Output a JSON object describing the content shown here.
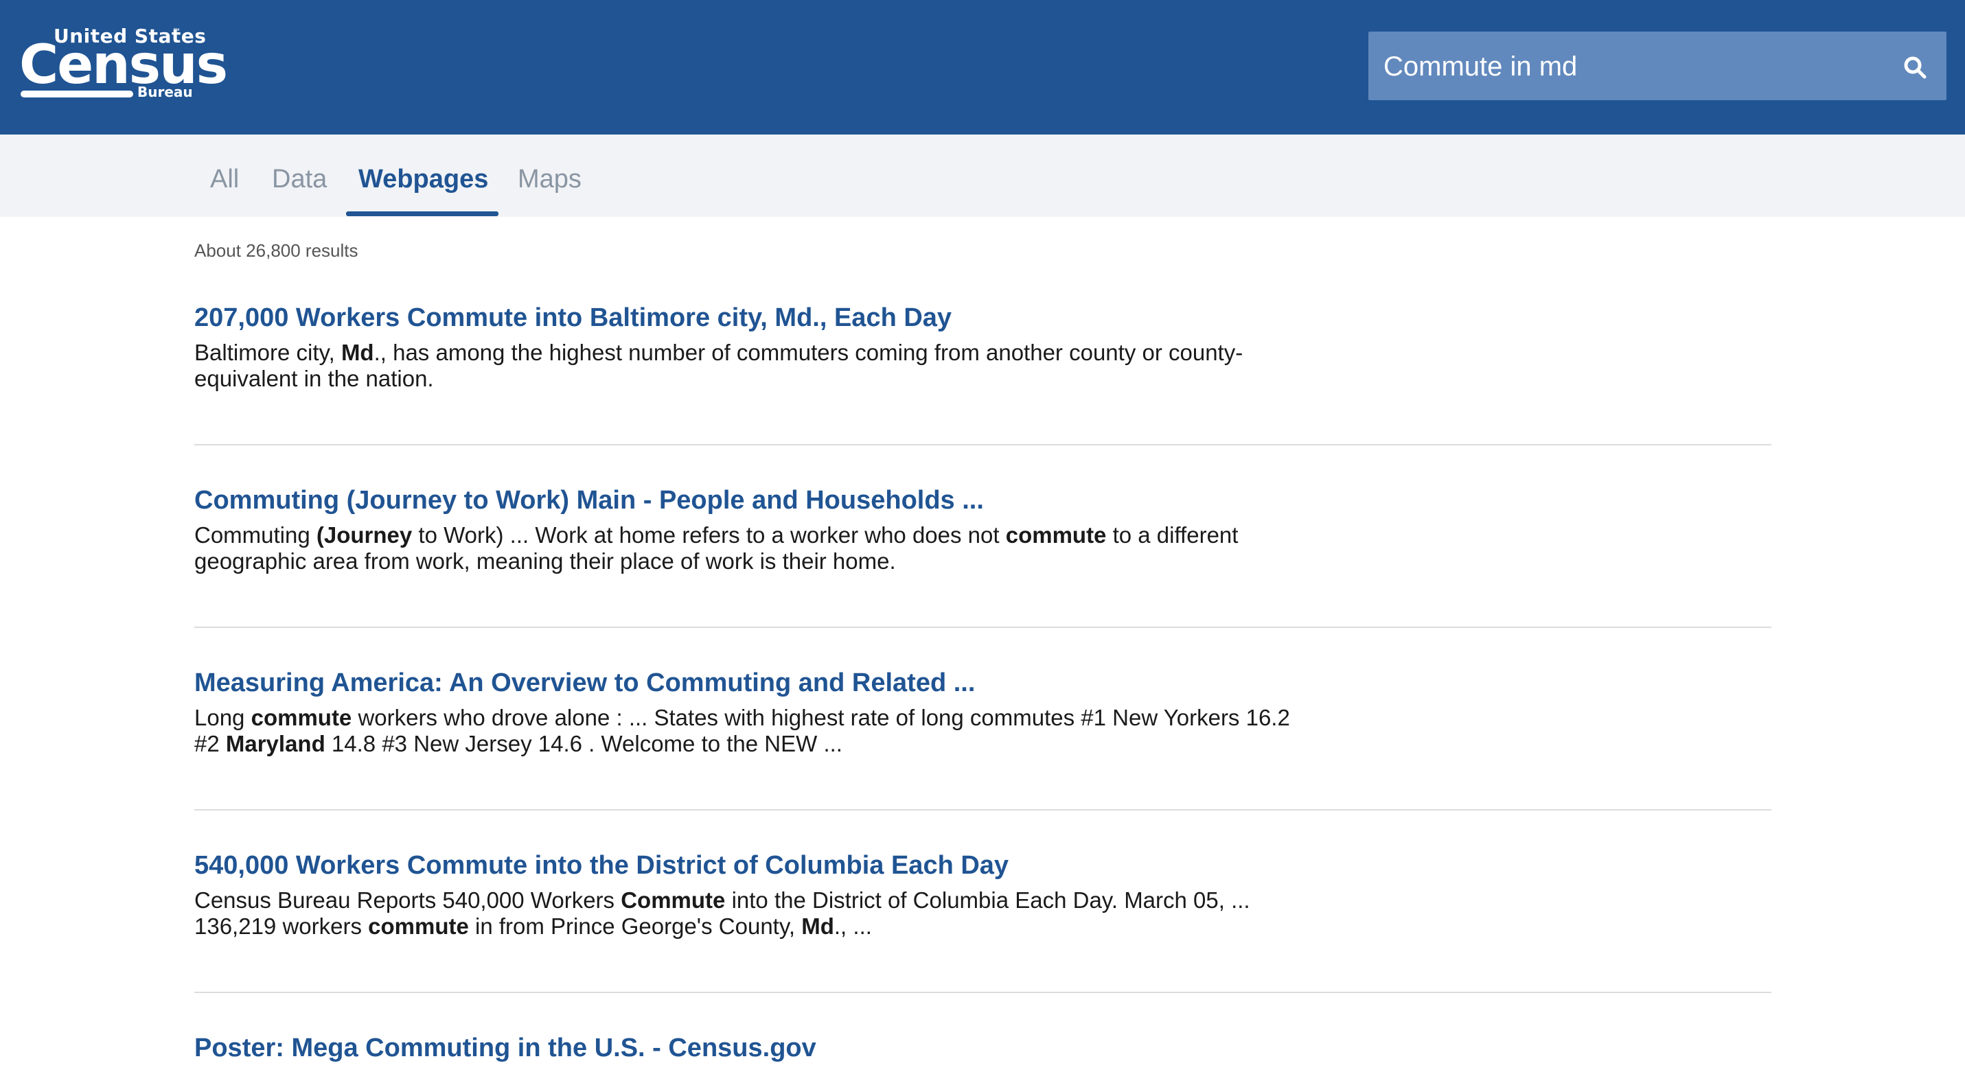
{
  "header": {
    "logo": {
      "line1": "United States",
      "tm": "™",
      "line2": "Census",
      "line3": "Bureau"
    },
    "search": {
      "value": "Commute in md",
      "icon": "search-icon"
    }
  },
  "tabs": [
    {
      "label": "All",
      "active": false
    },
    {
      "label": "Data",
      "active": false
    },
    {
      "label": "Webpages",
      "active": true
    },
    {
      "label": "Maps",
      "active": false
    }
  ],
  "results_count": "About 26,800 results",
  "results": [
    {
      "title": "207,000 Workers Commute into Baltimore city, Md., Each Day",
      "snippet": [
        {
          "t": "Baltimore city, "
        },
        {
          "t": "Md",
          "b": true
        },
        {
          "t": "., has among the highest number of commuters coming from another county or county-equivalent in the nation."
        }
      ]
    },
    {
      "title": "Commuting (Journey to Work) Main - People and Households ...",
      "snippet": [
        {
          "t": "Commuting "
        },
        {
          "t": "(Journey",
          "b": true
        },
        {
          "t": " to Work) ... Work at home refers to a worker who does not "
        },
        {
          "t": "commute",
          "b": true
        },
        {
          "t": " to a different geographic area from work, meaning their place of work is their home."
        }
      ]
    },
    {
      "title": "Measuring America: An Overview to Commuting and Related ...",
      "snippet": [
        {
          "t": "Long "
        },
        {
          "t": "commute",
          "b": true
        },
        {
          "t": " workers who drove alone : ... States with highest rate of long commutes #1 New Yorkers 16.2 #2 "
        },
        {
          "t": "Maryland",
          "b": true
        },
        {
          "t": " 14.8 #3 New Jersey 14.6 . Welcome to the NEW ..."
        }
      ]
    },
    {
      "title": "540,000 Workers Commute into the District of Columbia Each Day",
      "snippet": [
        {
          "t": "Census Bureau Reports 540,000 Workers "
        },
        {
          "t": "Commute",
          "b": true
        },
        {
          "t": " into the District of Columbia Each Day. March 05, ... 136,219 workers "
        },
        {
          "t": "commute",
          "b": true
        },
        {
          "t": " in from Prince George's County, "
        },
        {
          "t": "Md",
          "b": true
        },
        {
          "t": "., ..."
        }
      ]
    },
    {
      "title": "Poster: Mega Commuting in the U.S. - Census.gov",
      "snippet": []
    }
  ],
  "colors": {
    "header_bg": "#205493",
    "search_bg": "#6289bd",
    "link": "#205493",
    "tab_inactive": "#8a95a3"
  }
}
